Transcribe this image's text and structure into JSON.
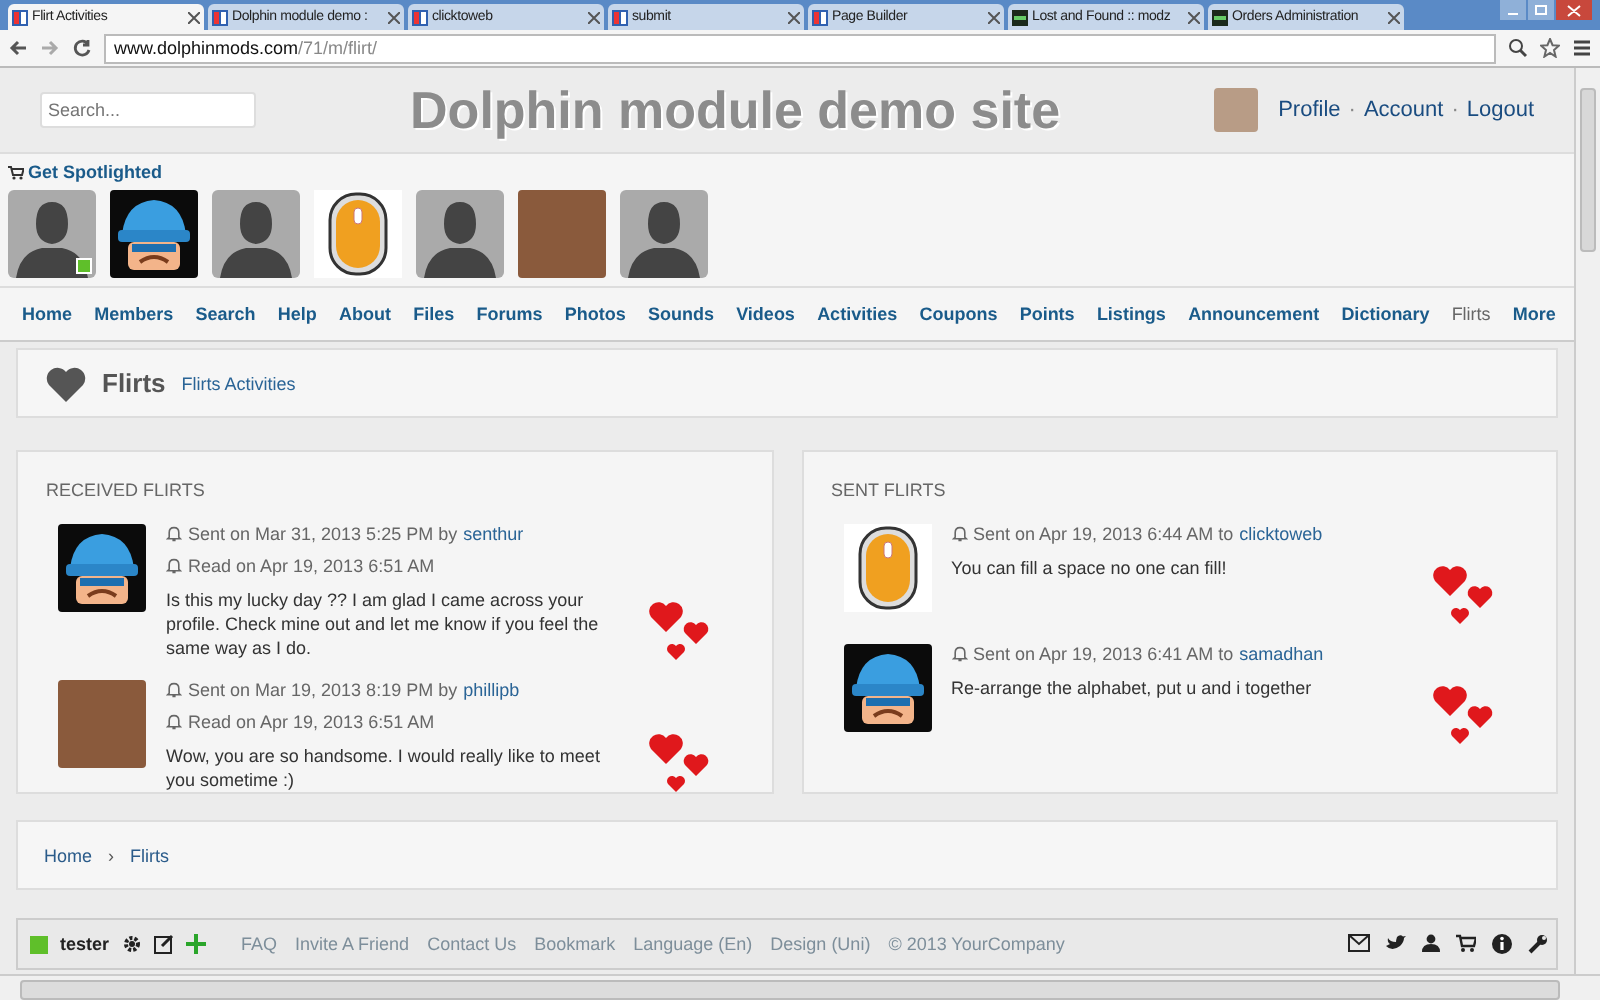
{
  "browser": {
    "tabs": [
      {
        "title": "Flirt Activities",
        "selected": true,
        "kind": "site"
      },
      {
        "title": "Dolphin module demo :",
        "selected": false,
        "kind": "site"
      },
      {
        "title": "clicktoweb",
        "selected": false,
        "kind": "site"
      },
      {
        "title": "submit",
        "selected": false,
        "kind": "site"
      },
      {
        "title": "Page Builder",
        "selected": false,
        "kind": "site"
      },
      {
        "title": "Lost and Found :: modz",
        "selected": false,
        "kind": "dark"
      },
      {
        "title": "Orders Administration",
        "selected": false,
        "kind": "dark"
      }
    ],
    "url_host": "www.dolphinmods.com",
    "url_path": "/71/m/flirt/"
  },
  "header": {
    "search_placeholder": "Search...",
    "site_title": "Dolphin module demo site",
    "user_links": [
      "Profile",
      "Account",
      "Logout"
    ],
    "separator": "·"
  },
  "spotlight": {
    "label": "Get Spotlighted",
    "members": [
      {
        "kind": "silhouette",
        "online": true
      },
      {
        "kind": "cartoon",
        "online": false
      },
      {
        "kind": "silhouette",
        "online": false
      },
      {
        "kind": "mouse",
        "online": false
      },
      {
        "kind": "silhouette",
        "online": false
      },
      {
        "kind": "photo",
        "online": false
      },
      {
        "kind": "silhouette",
        "online": false
      }
    ]
  },
  "nav": [
    {
      "label": "Home",
      "selected": false
    },
    {
      "label": "Members",
      "selected": false
    },
    {
      "label": "Search",
      "selected": false
    },
    {
      "label": "Help",
      "selected": false
    },
    {
      "label": "About",
      "selected": false
    },
    {
      "label": "Files",
      "selected": false
    },
    {
      "label": "Forums",
      "selected": false
    },
    {
      "label": "Photos",
      "selected": false
    },
    {
      "label": "Sounds",
      "selected": false
    },
    {
      "label": "Videos",
      "selected": false
    },
    {
      "label": "Activities",
      "selected": false
    },
    {
      "label": "Coupons",
      "selected": false
    },
    {
      "label": "Points",
      "selected": false
    },
    {
      "label": "Listings",
      "selected": false
    },
    {
      "label": "Announcement",
      "selected": false
    },
    {
      "label": "Dictionary",
      "selected": false
    },
    {
      "label": "Flirts",
      "selected": true
    },
    {
      "label": "More",
      "selected": false
    }
  ],
  "page_header": {
    "title": "Flirts",
    "link": "Flirts Activities"
  },
  "panels": [
    {
      "title": "RECEIVED FLIRTS",
      "items": [
        {
          "kind": "cartoon",
          "sent": "Sent on Mar 31, 2013 5:25 PM by",
          "user": "senthur",
          "read": "Read on Apr 19, 2013 6:51 AM",
          "message": "Is this my lucky day ?? I am glad I came across your profile. Check mine out and let me know if you feel the same way as I do."
        },
        {
          "kind": "photo",
          "sent": "Sent on Mar 19, 2013 8:19 PM by",
          "user": "phillipb",
          "read": "Read on Apr 19, 2013 6:51 AM",
          "message": "Wow, you are so handsome. I would really like to meet you sometime :)"
        }
      ]
    },
    {
      "title": "SENT FLIRTS",
      "items": [
        {
          "kind": "mouse",
          "sent": "Sent on Apr 19, 2013 6:44 AM to",
          "user": "clicktoweb",
          "message": "You can fill a space no one can fill!"
        },
        {
          "kind": "cartoon",
          "sent": "Sent on Apr 19, 2013 6:41 AM to",
          "user": "samadhan",
          "message": "Re-arrange the alphabet, put u and i together"
        }
      ]
    }
  ],
  "breadcrumb": {
    "items": [
      "Home",
      "Flirts"
    ],
    "separator": "›"
  },
  "footer": {
    "user": "tester",
    "links": [
      "FAQ",
      "Invite A Friend",
      "Contact Us",
      "Bookmark",
      "Language (En)",
      "Design (Uni)",
      "© 2013 YourCompany"
    ]
  }
}
